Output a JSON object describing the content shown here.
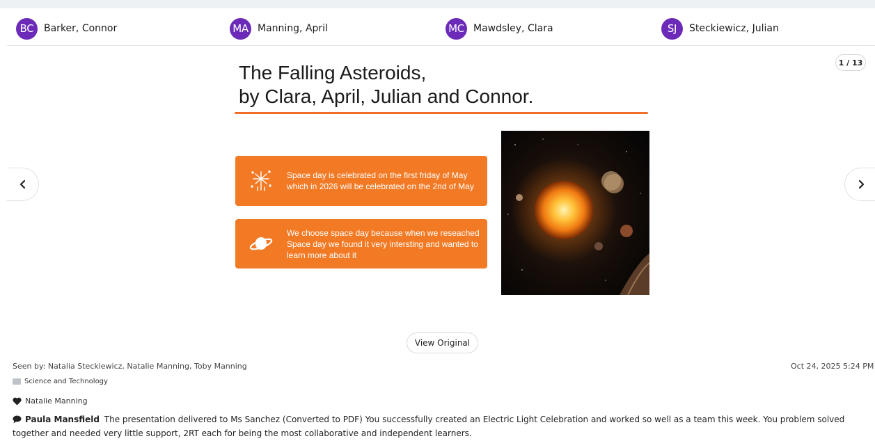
{
  "students": [
    {
      "initials": "BC",
      "name": "Barker, Connor"
    },
    {
      "initials": "MA",
      "name": "Manning, April"
    },
    {
      "initials": "MC",
      "name": "Mawdsley, Clara"
    },
    {
      "initials": "SJ",
      "name": "Steckiewicz, Julian"
    }
  ],
  "viewer": {
    "page_counter": "1 / 13",
    "prev_icon": "chevron-left-icon",
    "next_icon": "chevron-right-icon",
    "view_original_label": "View Original"
  },
  "slide": {
    "title_line1": "The Falling Asteroids,",
    "title_line2": "by Clara, April, Julian and Connor.",
    "accent_color": "#f37a25",
    "cards": [
      {
        "icon": "fireworks-icon",
        "text": "Space day is celebrated on the first friday of May which in 2026 will be celebrated on the 2nd of May"
      },
      {
        "icon": "planet-icon",
        "text": "We choose space day because when we reseached Space day we found it very intersting and wanted to learn more about it"
      }
    ],
    "image": "solar-system-image"
  },
  "post": {
    "seen_by": "Seen by: Natalia Steckiewicz, Natalie Manning, Toby Manning",
    "date": "Oct 24, 2025 5:24 PM",
    "category": "Science and Technology",
    "liked_by": "Natalie Manning",
    "comment_author": "Paula Mansfield",
    "comment_text": "The presentation delivered to Ms Sanchez (Converted to PDF) You successfully created an Electric Light Celebration and worked so well as a team this week. You problem solved together and needed very little support, 2RT each for being the most collaborative and independent learners."
  }
}
